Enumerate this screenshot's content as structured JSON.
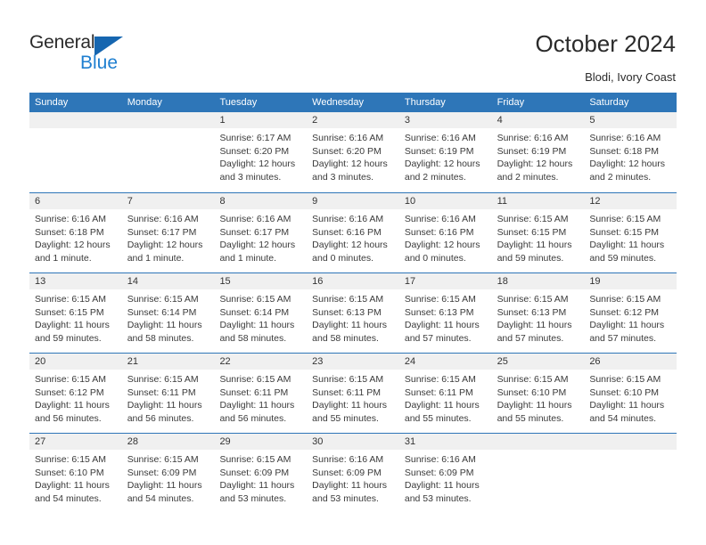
{
  "brand": {
    "name_line1": "General",
    "name_line2": "Blue",
    "triangle_color": "#1666b0",
    "blue_color": "#1f7fd0"
  },
  "header": {
    "title": "October 2024",
    "subtitle": "Blodi, Ivory Coast"
  },
  "theme": {
    "header_blue": "#2e76b8",
    "day_band_gray": "#f0f0f0",
    "text_color": "#3a3a3a"
  },
  "weekdays": [
    "Sunday",
    "Monday",
    "Tuesday",
    "Wednesday",
    "Thursday",
    "Friday",
    "Saturday"
  ],
  "weeks": [
    [
      {
        "day": "",
        "sunrise": "",
        "sunset": "",
        "daylight": "",
        "empty": true
      },
      {
        "day": "",
        "sunrise": "",
        "sunset": "",
        "daylight": "",
        "empty": true
      },
      {
        "day": "1",
        "sunrise": "Sunrise: 6:17 AM",
        "sunset": "Sunset: 6:20 PM",
        "daylight": "Daylight: 12 hours and 3 minutes."
      },
      {
        "day": "2",
        "sunrise": "Sunrise: 6:16 AM",
        "sunset": "Sunset: 6:20 PM",
        "daylight": "Daylight: 12 hours and 3 minutes."
      },
      {
        "day": "3",
        "sunrise": "Sunrise: 6:16 AM",
        "sunset": "Sunset: 6:19 PM",
        "daylight": "Daylight: 12 hours and 2 minutes."
      },
      {
        "day": "4",
        "sunrise": "Sunrise: 6:16 AM",
        "sunset": "Sunset: 6:19 PM",
        "daylight": "Daylight: 12 hours and 2 minutes."
      },
      {
        "day": "5",
        "sunrise": "Sunrise: 6:16 AM",
        "sunset": "Sunset: 6:18 PM",
        "daylight": "Daylight: 12 hours and 2 minutes."
      }
    ],
    [
      {
        "day": "6",
        "sunrise": "Sunrise: 6:16 AM",
        "sunset": "Sunset: 6:18 PM",
        "daylight": "Daylight: 12 hours and 1 minute."
      },
      {
        "day": "7",
        "sunrise": "Sunrise: 6:16 AM",
        "sunset": "Sunset: 6:17 PM",
        "daylight": "Daylight: 12 hours and 1 minute."
      },
      {
        "day": "8",
        "sunrise": "Sunrise: 6:16 AM",
        "sunset": "Sunset: 6:17 PM",
        "daylight": "Daylight: 12 hours and 1 minute."
      },
      {
        "day": "9",
        "sunrise": "Sunrise: 6:16 AM",
        "sunset": "Sunset: 6:16 PM",
        "daylight": "Daylight: 12 hours and 0 minutes."
      },
      {
        "day": "10",
        "sunrise": "Sunrise: 6:16 AM",
        "sunset": "Sunset: 6:16 PM",
        "daylight": "Daylight: 12 hours and 0 minutes."
      },
      {
        "day": "11",
        "sunrise": "Sunrise: 6:15 AM",
        "sunset": "Sunset: 6:15 PM",
        "daylight": "Daylight: 11 hours and 59 minutes."
      },
      {
        "day": "12",
        "sunrise": "Sunrise: 6:15 AM",
        "sunset": "Sunset: 6:15 PM",
        "daylight": "Daylight: 11 hours and 59 minutes."
      }
    ],
    [
      {
        "day": "13",
        "sunrise": "Sunrise: 6:15 AM",
        "sunset": "Sunset: 6:15 PM",
        "daylight": "Daylight: 11 hours and 59 minutes."
      },
      {
        "day": "14",
        "sunrise": "Sunrise: 6:15 AM",
        "sunset": "Sunset: 6:14 PM",
        "daylight": "Daylight: 11 hours and 58 minutes."
      },
      {
        "day": "15",
        "sunrise": "Sunrise: 6:15 AM",
        "sunset": "Sunset: 6:14 PM",
        "daylight": "Daylight: 11 hours and 58 minutes."
      },
      {
        "day": "16",
        "sunrise": "Sunrise: 6:15 AM",
        "sunset": "Sunset: 6:13 PM",
        "daylight": "Daylight: 11 hours and 58 minutes."
      },
      {
        "day": "17",
        "sunrise": "Sunrise: 6:15 AM",
        "sunset": "Sunset: 6:13 PM",
        "daylight": "Daylight: 11 hours and 57 minutes."
      },
      {
        "day": "18",
        "sunrise": "Sunrise: 6:15 AM",
        "sunset": "Sunset: 6:13 PM",
        "daylight": "Daylight: 11 hours and 57 minutes."
      },
      {
        "day": "19",
        "sunrise": "Sunrise: 6:15 AM",
        "sunset": "Sunset: 6:12 PM",
        "daylight": "Daylight: 11 hours and 57 minutes."
      }
    ],
    [
      {
        "day": "20",
        "sunrise": "Sunrise: 6:15 AM",
        "sunset": "Sunset: 6:12 PM",
        "daylight": "Daylight: 11 hours and 56 minutes."
      },
      {
        "day": "21",
        "sunrise": "Sunrise: 6:15 AM",
        "sunset": "Sunset: 6:11 PM",
        "daylight": "Daylight: 11 hours and 56 minutes."
      },
      {
        "day": "22",
        "sunrise": "Sunrise: 6:15 AM",
        "sunset": "Sunset: 6:11 PM",
        "daylight": "Daylight: 11 hours and 56 minutes."
      },
      {
        "day": "23",
        "sunrise": "Sunrise: 6:15 AM",
        "sunset": "Sunset: 6:11 PM",
        "daylight": "Daylight: 11 hours and 55 minutes."
      },
      {
        "day": "24",
        "sunrise": "Sunrise: 6:15 AM",
        "sunset": "Sunset: 6:11 PM",
        "daylight": "Daylight: 11 hours and 55 minutes."
      },
      {
        "day": "25",
        "sunrise": "Sunrise: 6:15 AM",
        "sunset": "Sunset: 6:10 PM",
        "daylight": "Daylight: 11 hours and 55 minutes."
      },
      {
        "day": "26",
        "sunrise": "Sunrise: 6:15 AM",
        "sunset": "Sunset: 6:10 PM",
        "daylight": "Daylight: 11 hours and 54 minutes."
      }
    ],
    [
      {
        "day": "27",
        "sunrise": "Sunrise: 6:15 AM",
        "sunset": "Sunset: 6:10 PM",
        "daylight": "Daylight: 11 hours and 54 minutes."
      },
      {
        "day": "28",
        "sunrise": "Sunrise: 6:15 AM",
        "sunset": "Sunset: 6:09 PM",
        "daylight": "Daylight: 11 hours and 54 minutes."
      },
      {
        "day": "29",
        "sunrise": "Sunrise: 6:15 AM",
        "sunset": "Sunset: 6:09 PM",
        "daylight": "Daylight: 11 hours and 53 minutes."
      },
      {
        "day": "30",
        "sunrise": "Sunrise: 6:16 AM",
        "sunset": "Sunset: 6:09 PM",
        "daylight": "Daylight: 11 hours and 53 minutes."
      },
      {
        "day": "31",
        "sunrise": "Sunrise: 6:16 AM",
        "sunset": "Sunset: 6:09 PM",
        "daylight": "Daylight: 11 hours and 53 minutes."
      },
      {
        "day": "",
        "sunrise": "",
        "sunset": "",
        "daylight": "",
        "empty": true
      },
      {
        "day": "",
        "sunrise": "",
        "sunset": "",
        "daylight": "",
        "empty": true
      }
    ]
  ]
}
